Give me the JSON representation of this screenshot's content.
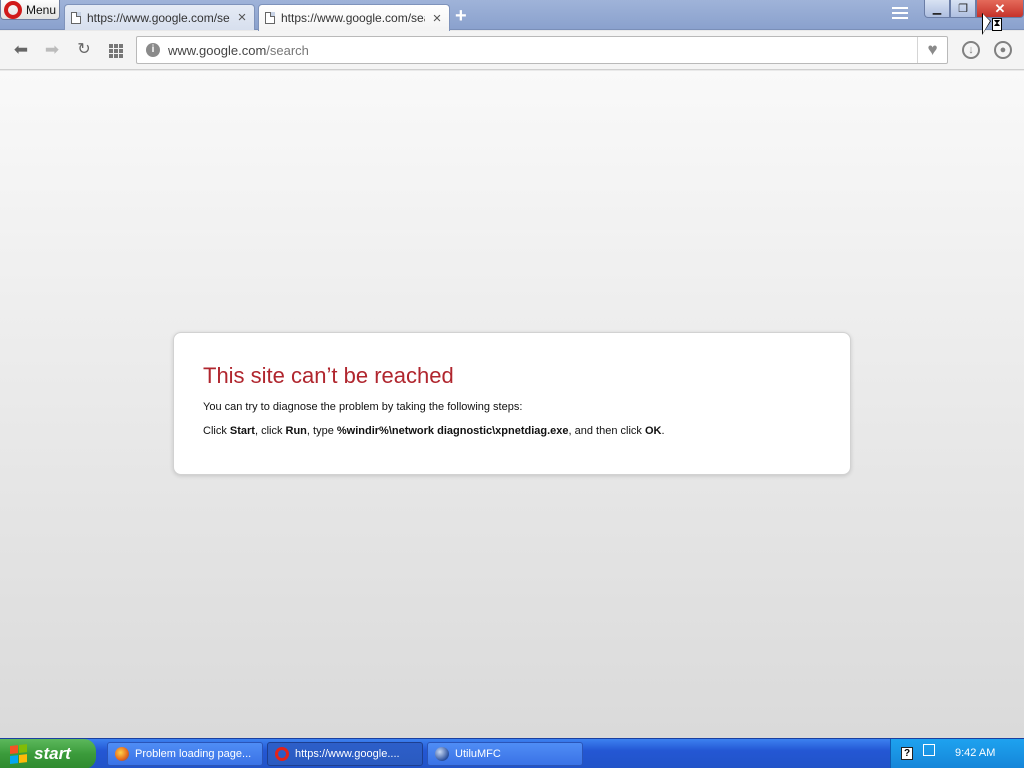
{
  "browser": {
    "menu_label": "Menu",
    "tabs": [
      {
        "title": "https://www.google.com/search",
        "active": false
      },
      {
        "title": "https://www.google.com/search",
        "active": true
      }
    ],
    "new_tab_icon": "plus-icon",
    "window_controls": {
      "minimize": "minimize-icon",
      "maximize": "restore-icon",
      "close": "close-icon"
    }
  },
  "toolbar": {
    "address": {
      "domain": "www.google.com",
      "path": "/search"
    },
    "icons": [
      "back-arrow-icon",
      "forward-arrow-icon",
      "reload-icon",
      "speed-dial-grid-icon",
      "site-info-icon",
      "heart-icon",
      "downloads-icon",
      "account-icon"
    ]
  },
  "error_page": {
    "title": "This site can’t be reached",
    "intro": "You can try to diagnose the problem by taking the following steps:",
    "steps": {
      "t1": "Click ",
      "b1": "Start",
      "t2": ", click ",
      "b2": "Run",
      "t3": ", type ",
      "b3": "%windir%\\network diagnostic\\xpnetdiag.exe",
      "t4": ", and then click ",
      "b4": "OK",
      "t5": "."
    }
  },
  "taskbar": {
    "start_label": "start",
    "tasks": [
      {
        "label": "Problem loading page...",
        "icon": "firefox-icon",
        "active": false
      },
      {
        "label": "https://www.google....",
        "icon": "opera-icon",
        "active": true
      },
      {
        "label": "UtiluMFC",
        "icon": "app-globe-icon",
        "active": false
      }
    ],
    "tray": {
      "help_icon": "?",
      "clock": "9:42 AM"
    }
  },
  "colors": {
    "error_title": "#b0262e",
    "opera_red": "#d11a1a",
    "taskbar_blue": "#2457d4",
    "start_green": "#3b9b3b",
    "tray_blue": "#1585d8"
  }
}
